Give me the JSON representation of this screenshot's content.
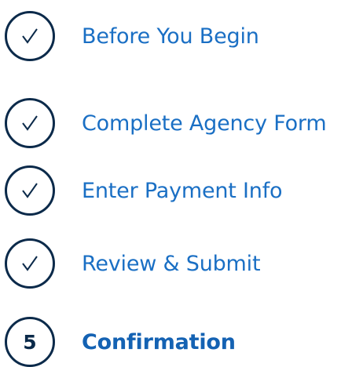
{
  "steps": [
    {
      "label": "Before You Begin",
      "status": "complete",
      "icon": "checkmark-icon"
    },
    {
      "label": "Complete Agency Form",
      "status": "complete",
      "icon": "checkmark-icon"
    },
    {
      "label": "Enter Payment Info",
      "status": "complete",
      "icon": "checkmark-icon"
    },
    {
      "label": "Review & Submit",
      "status": "complete",
      "icon": "checkmark-icon"
    },
    {
      "label": "Confirmation",
      "status": "current",
      "number": "5"
    }
  ],
  "colors": {
    "circle_border": "#0b2a4a",
    "link": "#1a6fc4",
    "current": "#1462b3"
  }
}
